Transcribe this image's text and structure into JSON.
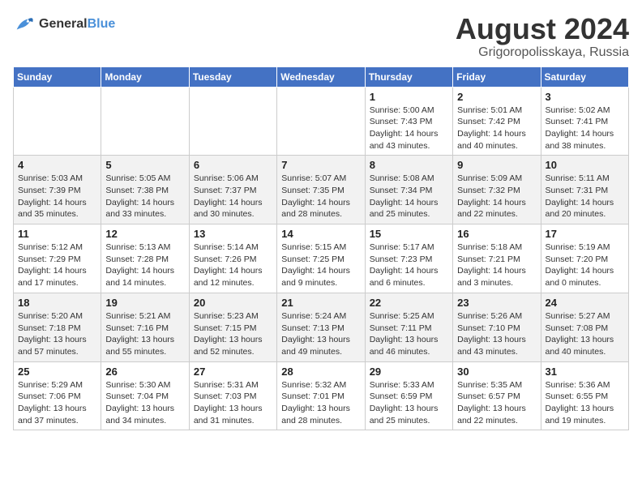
{
  "header": {
    "logo_line1": "General",
    "logo_line2": "Blue",
    "month": "August 2024",
    "location": "Grigoropolisskaya, Russia"
  },
  "weekdays": [
    "Sunday",
    "Monday",
    "Tuesday",
    "Wednesday",
    "Thursday",
    "Friday",
    "Saturday"
  ],
  "weeks": [
    [
      {
        "day": "",
        "info": ""
      },
      {
        "day": "",
        "info": ""
      },
      {
        "day": "",
        "info": ""
      },
      {
        "day": "",
        "info": ""
      },
      {
        "day": "1",
        "info": "Sunrise: 5:00 AM\nSunset: 7:43 PM\nDaylight: 14 hours\nand 43 minutes."
      },
      {
        "day": "2",
        "info": "Sunrise: 5:01 AM\nSunset: 7:42 PM\nDaylight: 14 hours\nand 40 minutes."
      },
      {
        "day": "3",
        "info": "Sunrise: 5:02 AM\nSunset: 7:41 PM\nDaylight: 14 hours\nand 38 minutes."
      }
    ],
    [
      {
        "day": "4",
        "info": "Sunrise: 5:03 AM\nSunset: 7:39 PM\nDaylight: 14 hours\nand 35 minutes."
      },
      {
        "day": "5",
        "info": "Sunrise: 5:05 AM\nSunset: 7:38 PM\nDaylight: 14 hours\nand 33 minutes."
      },
      {
        "day": "6",
        "info": "Sunrise: 5:06 AM\nSunset: 7:37 PM\nDaylight: 14 hours\nand 30 minutes."
      },
      {
        "day": "7",
        "info": "Sunrise: 5:07 AM\nSunset: 7:35 PM\nDaylight: 14 hours\nand 28 minutes."
      },
      {
        "day": "8",
        "info": "Sunrise: 5:08 AM\nSunset: 7:34 PM\nDaylight: 14 hours\nand 25 minutes."
      },
      {
        "day": "9",
        "info": "Sunrise: 5:09 AM\nSunset: 7:32 PM\nDaylight: 14 hours\nand 22 minutes."
      },
      {
        "day": "10",
        "info": "Sunrise: 5:11 AM\nSunset: 7:31 PM\nDaylight: 14 hours\nand 20 minutes."
      }
    ],
    [
      {
        "day": "11",
        "info": "Sunrise: 5:12 AM\nSunset: 7:29 PM\nDaylight: 14 hours\nand 17 minutes."
      },
      {
        "day": "12",
        "info": "Sunrise: 5:13 AM\nSunset: 7:28 PM\nDaylight: 14 hours\nand 14 minutes."
      },
      {
        "day": "13",
        "info": "Sunrise: 5:14 AM\nSunset: 7:26 PM\nDaylight: 14 hours\nand 12 minutes."
      },
      {
        "day": "14",
        "info": "Sunrise: 5:15 AM\nSunset: 7:25 PM\nDaylight: 14 hours\nand 9 minutes."
      },
      {
        "day": "15",
        "info": "Sunrise: 5:17 AM\nSunset: 7:23 PM\nDaylight: 14 hours\nand 6 minutes."
      },
      {
        "day": "16",
        "info": "Sunrise: 5:18 AM\nSunset: 7:21 PM\nDaylight: 14 hours\nand 3 minutes."
      },
      {
        "day": "17",
        "info": "Sunrise: 5:19 AM\nSunset: 7:20 PM\nDaylight: 14 hours\nand 0 minutes."
      }
    ],
    [
      {
        "day": "18",
        "info": "Sunrise: 5:20 AM\nSunset: 7:18 PM\nDaylight: 13 hours\nand 57 minutes."
      },
      {
        "day": "19",
        "info": "Sunrise: 5:21 AM\nSunset: 7:16 PM\nDaylight: 13 hours\nand 55 minutes."
      },
      {
        "day": "20",
        "info": "Sunrise: 5:23 AM\nSunset: 7:15 PM\nDaylight: 13 hours\nand 52 minutes."
      },
      {
        "day": "21",
        "info": "Sunrise: 5:24 AM\nSunset: 7:13 PM\nDaylight: 13 hours\nand 49 minutes."
      },
      {
        "day": "22",
        "info": "Sunrise: 5:25 AM\nSunset: 7:11 PM\nDaylight: 13 hours\nand 46 minutes."
      },
      {
        "day": "23",
        "info": "Sunrise: 5:26 AM\nSunset: 7:10 PM\nDaylight: 13 hours\nand 43 minutes."
      },
      {
        "day": "24",
        "info": "Sunrise: 5:27 AM\nSunset: 7:08 PM\nDaylight: 13 hours\nand 40 minutes."
      }
    ],
    [
      {
        "day": "25",
        "info": "Sunrise: 5:29 AM\nSunset: 7:06 PM\nDaylight: 13 hours\nand 37 minutes."
      },
      {
        "day": "26",
        "info": "Sunrise: 5:30 AM\nSunset: 7:04 PM\nDaylight: 13 hours\nand 34 minutes."
      },
      {
        "day": "27",
        "info": "Sunrise: 5:31 AM\nSunset: 7:03 PM\nDaylight: 13 hours\nand 31 minutes."
      },
      {
        "day": "28",
        "info": "Sunrise: 5:32 AM\nSunset: 7:01 PM\nDaylight: 13 hours\nand 28 minutes."
      },
      {
        "day": "29",
        "info": "Sunrise: 5:33 AM\nSunset: 6:59 PM\nDaylight: 13 hours\nand 25 minutes."
      },
      {
        "day": "30",
        "info": "Sunrise: 5:35 AM\nSunset: 6:57 PM\nDaylight: 13 hours\nand 22 minutes."
      },
      {
        "day": "31",
        "info": "Sunrise: 5:36 AM\nSunset: 6:55 PM\nDaylight: 13 hours\nand 19 minutes."
      }
    ]
  ]
}
